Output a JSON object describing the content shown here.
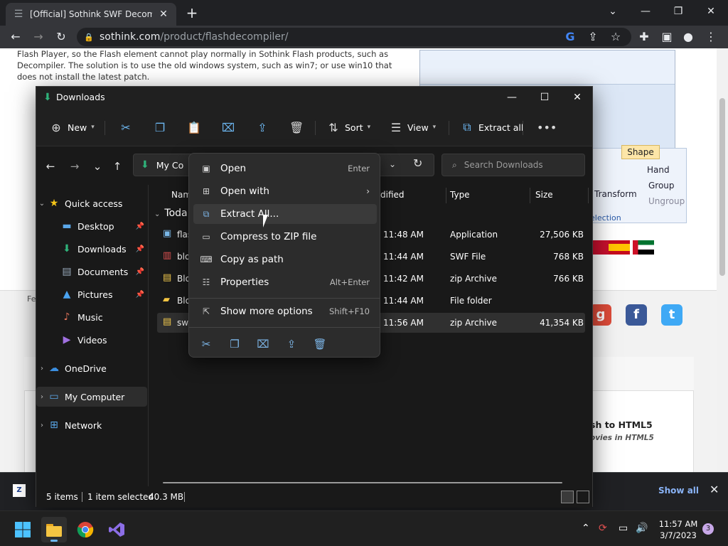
{
  "browser": {
    "tab_title": "[Official] Sothink SWF Decompile",
    "url_host": "sothink.com",
    "url_path": "/product/flashdecompiler/"
  },
  "webpage": {
    "intro_text": "Flash Player, so the Flash element cannot play normally in Sothink Flash products, such as Decompiler. The solution is to use the old windows system, such as win7; or use win10 that does not install the latest patch.",
    "shape_tab": "Shape",
    "shape_items": [
      "Transform",
      "Hand",
      "Group",
      "Ungroup"
    ],
    "shape_section": "election",
    "side_text": "Fe",
    "heading": "sh to HTML5",
    "subheading": "ovies in HTML5",
    "colors": {
      "facebook": "#3b5998",
      "twitter": "#3fa9f5",
      "google": "#dd4b39"
    }
  },
  "download_bar": {
    "show_all": "Show all"
  },
  "explorer": {
    "title": "Downloads",
    "commands": {
      "new": "New",
      "sort": "Sort",
      "view": "View",
      "extract_all": "Extract all"
    },
    "address": "My Co",
    "search_placeholder": "Search Downloads",
    "nav": {
      "quick_access": "Quick access",
      "desktop": "Desktop",
      "downloads": "Downloads",
      "documents": "Documents",
      "pictures": "Pictures",
      "music": "Music",
      "videos": "Videos",
      "onedrive": "OneDrive",
      "my_computer": "My Computer",
      "network": "Network"
    },
    "columns": {
      "name": "Nam",
      "modified": "dified",
      "type": "Type",
      "size": "Size"
    },
    "group": "Toda",
    "rows": [
      {
        "name": "flas",
        "time": "11:48 AM",
        "type": "Application",
        "size": "27,506 KB",
        "icon": "app-icon"
      },
      {
        "name": "blo",
        "time": "11:44 AM",
        "type": "SWF File",
        "size": "768 KB",
        "icon": "swf-icon"
      },
      {
        "name": "Blo",
        "time": "11:42 AM",
        "type": "zip Archive",
        "size": "766 KB",
        "icon": "zip-icon"
      },
      {
        "name": "Blo",
        "time": "11:44 AM",
        "type": "File folder",
        "size": "",
        "icon": "folder-icon"
      },
      {
        "name": "swf",
        "time": "11:56 AM",
        "type": "zip Archive",
        "size": "41,354 KB",
        "icon": "zip-icon"
      }
    ],
    "status": {
      "items": "5 items",
      "selected": "1 item selected",
      "size": "40.3 MB"
    }
  },
  "context_menu": {
    "items": [
      {
        "label": "Open",
        "shortcut": "Enter"
      },
      {
        "label": "Open with",
        "shortcut": ""
      },
      {
        "label": "Extract All...",
        "shortcut": ""
      },
      {
        "label": "Compress to ZIP file",
        "shortcut": ""
      },
      {
        "label": "Copy as path",
        "shortcut": ""
      },
      {
        "label": "Properties",
        "shortcut": "Alt+Enter"
      },
      {
        "label": "Show more options",
        "shortcut": "Shift+F10"
      }
    ]
  },
  "taskbar": {
    "time": "11:57 AM",
    "date": "3/7/2023",
    "notifications": "3"
  }
}
